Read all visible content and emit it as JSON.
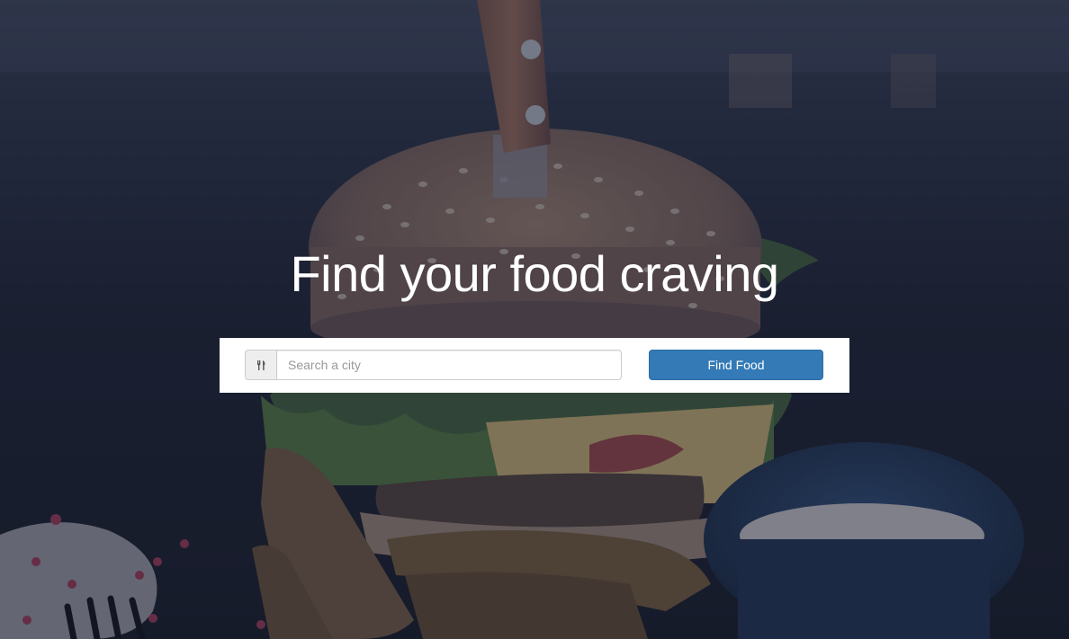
{
  "hero": {
    "headline": "Find your food craving",
    "background_image": "burger-photo"
  },
  "search": {
    "icon": "cutlery-icon",
    "placeholder": "Search a city",
    "value": "",
    "button_label": "Find Food"
  },
  "colors": {
    "overlay": "#1c2233",
    "button": "#337ab7",
    "panel": "#ffffff"
  }
}
